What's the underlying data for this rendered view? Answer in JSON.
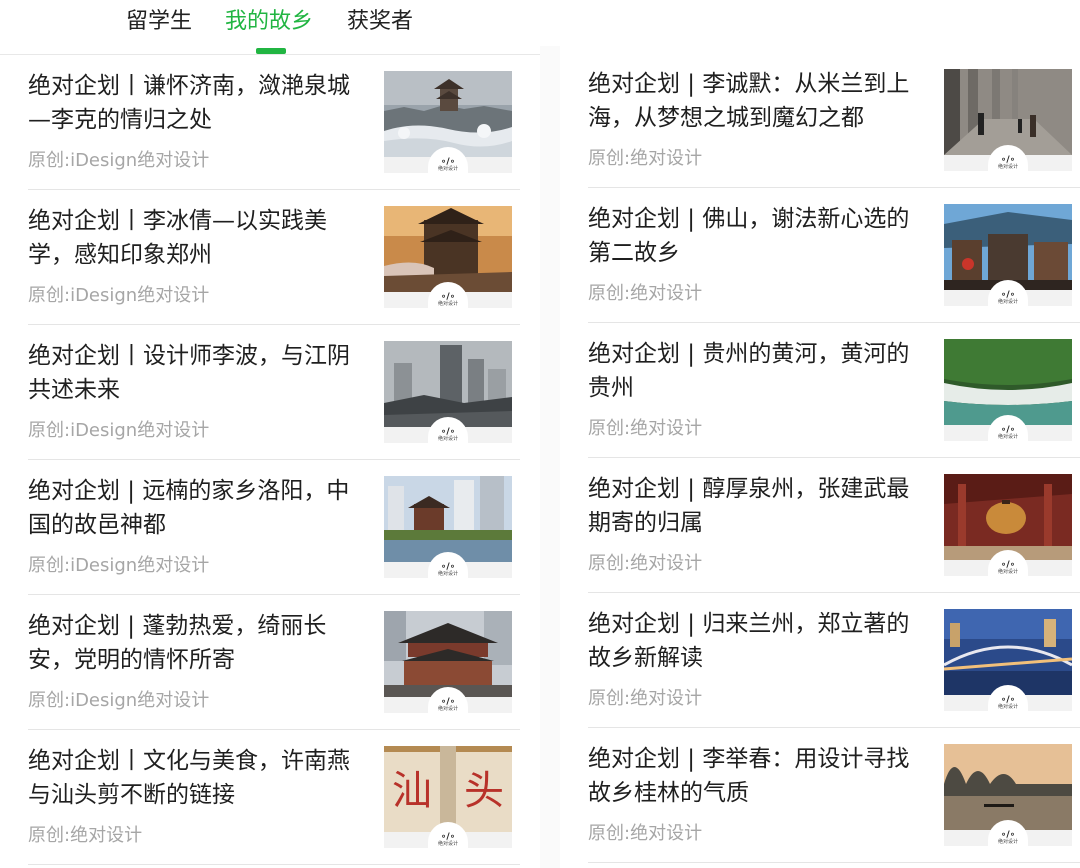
{
  "tabs": [
    {
      "label": "留学生",
      "active": false
    },
    {
      "label": "我的故乡",
      "active": true
    },
    {
      "label": "获奖者",
      "active": false
    }
  ],
  "accent_color": "#21b542",
  "thumbnail_logo_text": "绝对设计",
  "left_column": [
    {
      "title": "绝对企划丨谦怀济南，潋滟泉城—李克的情归之处",
      "source": "原创:iDesign绝对设计",
      "thumb": "snowy-city-pavilion-image"
    },
    {
      "title": "绝对企划丨李冰倩—以实践美学，感知印象郑州",
      "source": "原创:iDesign绝对设计",
      "thumb": "city-tower-sunset-image"
    },
    {
      "title": "绝对企划丨设计师李波，与江阴共述未来",
      "source": "原创:iDesign绝对设计",
      "thumb": "city-skyline-rooftops-image"
    },
    {
      "title": "绝对企划 | 远楠的家乡洛阳，中国的故邑神都",
      "source": "原创:iDesign绝对设计",
      "thumb": "luoyang-tower-river-image"
    },
    {
      "title": "绝对企划 | 蓬勃热爱，绮丽长安，党明的情怀所寄",
      "source": "原创:iDesign绝对设计",
      "thumb": "xian-drum-tower-image"
    },
    {
      "title": "绝对企划丨文化与美食，许南燕与汕头剪不断的链接",
      "source": "原创:绝对设计",
      "thumb": "shantou-red-characters-image"
    }
  ],
  "right_column": [
    {
      "title": "绝对企划 | 李诚默：从米兰到上海，从梦想之城到魔幻之都",
      "source": "原创:绝对设计",
      "thumb": "arcade-photographers-image"
    },
    {
      "title": "绝对企划 | 佛山，谢法新心选的第二故乡",
      "source": "原创:绝对设计",
      "thumb": "foshan-ornate-roof-image"
    },
    {
      "title": "绝对企划 | 贵州的黄河，黄河的贵州",
      "source": "原创:绝对设计",
      "thumb": "guizhou-waterfall-image"
    },
    {
      "title": "绝对企划 | 醇厚泉州，张建武最期寄的归属",
      "source": "原创:绝对设计",
      "thumb": "quanzhou-temple-lantern-image"
    },
    {
      "title": "绝对企划 | 归来兰州，郑立著的故乡新解读",
      "source": "原创:绝对设计",
      "thumb": "lanzhou-bridge-night-image"
    },
    {
      "title": "绝对企划 | 李举春：用设计寻找故乡桂林的气质",
      "source": "原创:绝对设计",
      "thumb": "guilin-karst-river-image"
    }
  ]
}
